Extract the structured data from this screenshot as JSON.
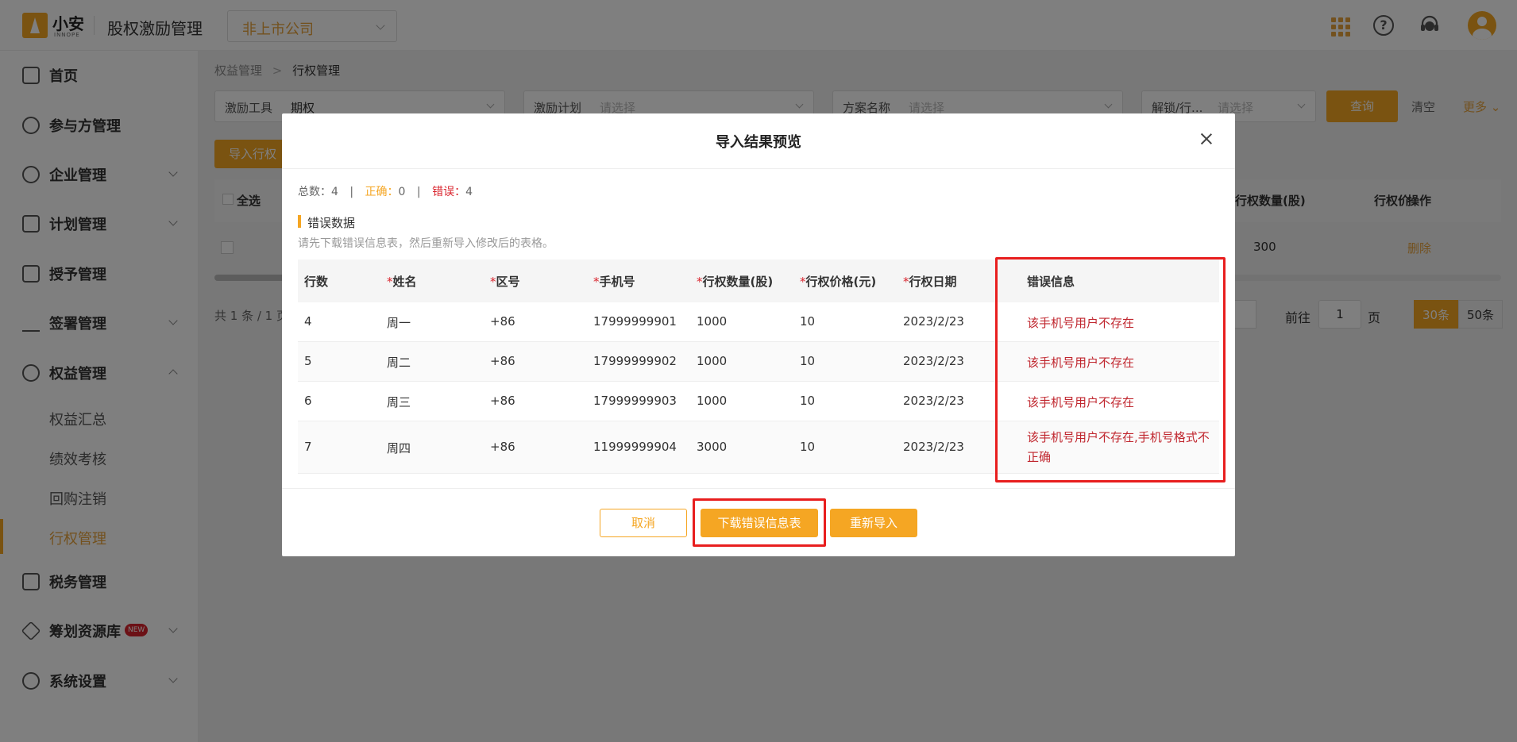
{
  "header": {
    "logo_name": "小安",
    "logo_sub": "INNOPE",
    "app_title": "股权激励管理",
    "company_select": "非上市公司"
  },
  "sidebar": {
    "items": [
      {
        "label": "首页",
        "icon": "home-icon"
      },
      {
        "label": "参与方管理",
        "icon": "users-icon"
      },
      {
        "label": "企业管理",
        "icon": "enterprise-icon"
      },
      {
        "label": "计划管理",
        "icon": "plan-icon"
      },
      {
        "label": "授予管理",
        "icon": "grant-icon"
      },
      {
        "label": "签署管理",
        "icon": "sign-icon"
      },
      {
        "label": "权益管理",
        "icon": "equity-icon"
      },
      {
        "label": "税务管理",
        "icon": "tax-icon"
      },
      {
        "label": "筹划资源库",
        "icon": "layers-icon",
        "badge": "NEW"
      },
      {
        "label": "系统设置",
        "icon": "settings-icon"
      }
    ],
    "sub_items": [
      "权益汇总",
      "绩效考核",
      "回购注销",
      "行权管理"
    ]
  },
  "main": {
    "breadcrumb": [
      "权益管理",
      "行权管理"
    ],
    "filters": [
      {
        "label": "激励工具",
        "value": "期权"
      },
      {
        "label": "激励计划",
        "placeholder": "请选择"
      },
      {
        "label": "方案名称",
        "placeholder": "请选择"
      },
      {
        "label": "解锁/行...",
        "placeholder": "请选择"
      }
    ],
    "query_button": "查询",
    "clear_link": "清空",
    "more_link": "更多",
    "import_button": "导入行权",
    "select_all": "全选",
    "bg_columns": [
      "行权数量(股)",
      "行权价",
      "操作"
    ],
    "bg_row": {
      "quantity": "300",
      "delete": "删除"
    },
    "total_text": "共 1 条 / 1 页",
    "pagination": {
      "goto": "前往",
      "page_value": "1",
      "page_unit": "页",
      "sizes": [
        "30条",
        "50条"
      ]
    }
  },
  "modal": {
    "title": "导入结果预览",
    "summary": {
      "total_label": "总数：",
      "total": "4",
      "correct_label": "正确：",
      "correct": "0",
      "error_label": "错误：",
      "error": "4"
    },
    "section_title": "错误数据",
    "section_hint": "请先下载错误信息表，然后重新导入修改后的表格。",
    "columns": [
      "行数",
      "姓名",
      "区号",
      "手机号",
      "行权数量(股)",
      "行权价格(元)",
      "行权日期",
      "错误信息"
    ],
    "rows": [
      {
        "row": "4",
        "name": "周一",
        "area": "+86",
        "phone": "17999999901",
        "qty": "1000",
        "price": "10",
        "date": "2023/2/23",
        "error": "该手机号用户不存在"
      },
      {
        "row": "5",
        "name": "周二",
        "area": "+86",
        "phone": "17999999902",
        "qty": "1000",
        "price": "10",
        "date": "2023/2/23",
        "error": "该手机号用户不存在"
      },
      {
        "row": "6",
        "name": "周三",
        "area": "+86",
        "phone": "17999999903",
        "qty": "1000",
        "price": "10",
        "date": "2023/2/23",
        "error": "该手机号用户不存在"
      },
      {
        "row": "7",
        "name": "周四",
        "area": "+86",
        "phone": "11999999904",
        "qty": "3000",
        "price": "10",
        "date": "2023/2/23",
        "error": "该手机号用户不存在,手机号格式不正确"
      }
    ],
    "buttons": {
      "cancel": "取消",
      "download": "下载错误信息表",
      "reimport": "重新导入"
    }
  },
  "colors": {
    "accent": "#f5a623",
    "error": "#d9232c",
    "highlight": "#e81e1e"
  }
}
